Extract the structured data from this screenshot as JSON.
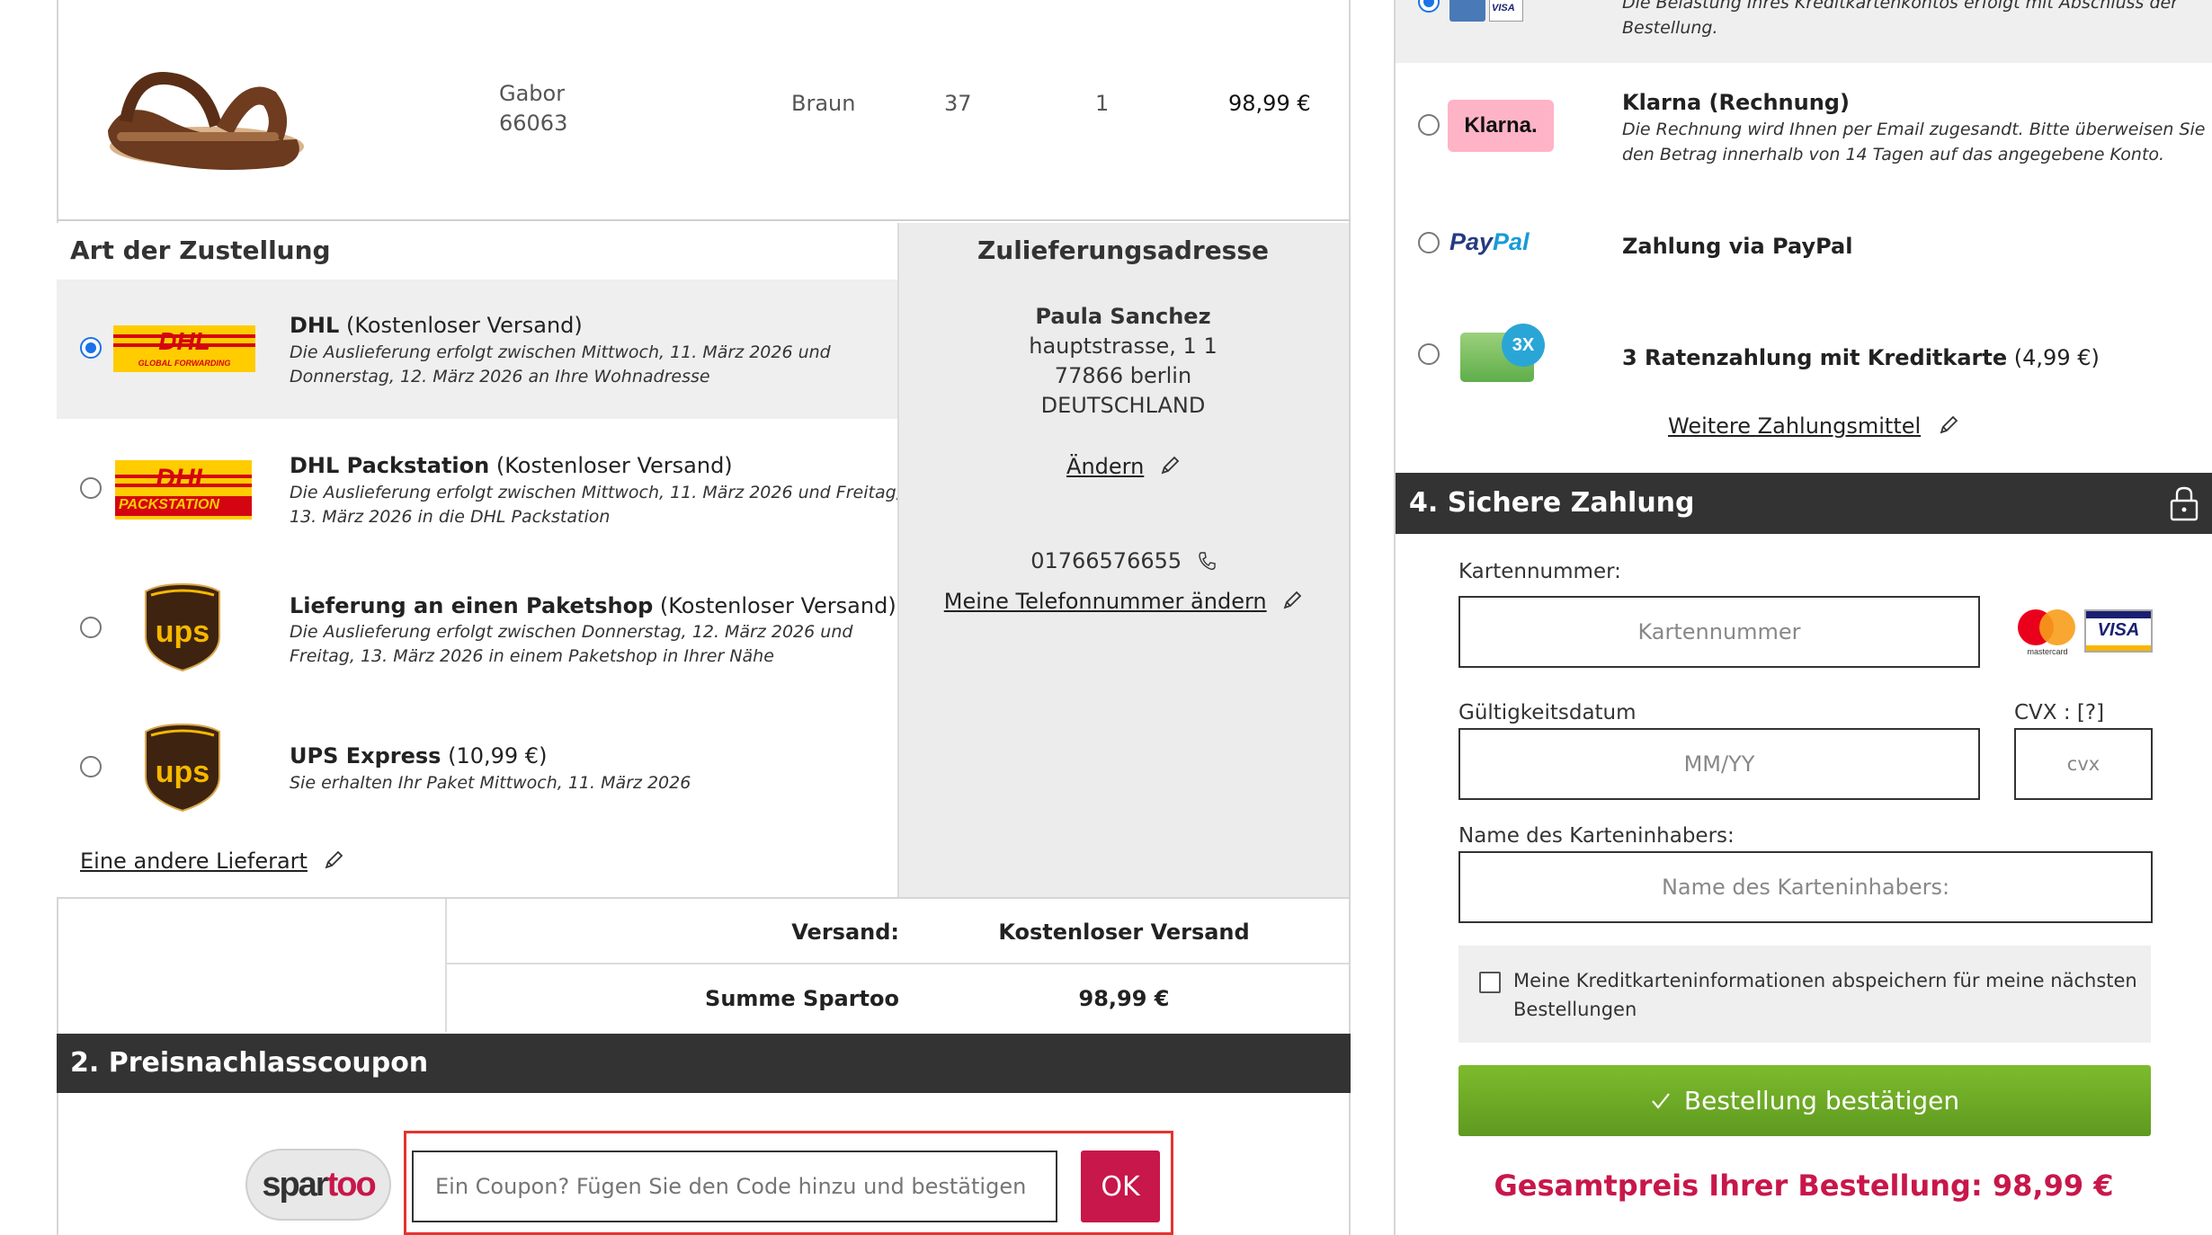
{
  "product": {
    "brand": "Gabor",
    "model": "66063",
    "color": "Braun",
    "size": "37",
    "quantity": "1",
    "price": "98,99 €"
  },
  "delivery": {
    "title": "Art der Zustellung",
    "options": [
      {
        "name": "DHL",
        "note": "(Kostenloser Versand)",
        "desc1": "Die Auslieferung erfolgt zwischen Mittwoch, 11. März 2026 und",
        "desc2": "Donnerstag, 12. März 2026 an Ihre Wohnadresse",
        "logo_text": "DHL",
        "logo_sub": "GLOBAL FORWARDING"
      },
      {
        "name": "DHL Packstation",
        "note": "(Kostenloser Versand)",
        "desc1": "Die Auslieferung erfolgt zwischen Mittwoch, 11. März 2026 und Freitag,",
        "desc2": "13. März 2026 in die DHL Packstation",
        "logo_text": "DHL",
        "logo_sub": "PACKSTATION"
      },
      {
        "name": "Lieferung an einen Paketshop",
        "note": "(Kostenloser Versand)",
        "desc1": "Die Auslieferung erfolgt zwischen Donnerstag, 12. März 2026 und",
        "desc2": "Freitag, 13. März 2026 in einem Paketshop in Ihrer Nähe",
        "logo_text": "ups"
      },
      {
        "name": "UPS Express",
        "note": "(10,99 €)",
        "desc1": "Sie erhalten Ihr Paket Mittwoch, 11. März 2026",
        "desc2": "",
        "logo_text": "ups"
      }
    ],
    "other_link": "Eine andere Lieferart"
  },
  "address": {
    "title": "Zulieferungsadresse",
    "name": "Paula Sanchez",
    "street": "hauptstrasse, 1 1",
    "city": "77866 berlin",
    "country": "DEUTSCHLAND",
    "change_link": "Ändern",
    "phone": "01766576655",
    "phone_link": "Meine Telefonnummer ändern"
  },
  "summary": {
    "shipping_label": "Versand:",
    "shipping_value": "Kostenloser Versand",
    "total_label": "Summe Spartoo",
    "total_value": "98,99 €"
  },
  "coupon": {
    "title": "2. Preisnachlasscoupon",
    "logo_a": "spar",
    "logo_b": "too",
    "placeholder": "Ein Coupon? Fügen Sie den Code hinzu und bestätigen",
    "ok_label": "OK"
  },
  "payment": {
    "card_note1": "Die Belastung Ihres Kreditkartenkontos erfolgt mit Abschluss der",
    "card_note2": "Bestellung.",
    "visa_mini": "VISA",
    "klarna_logo": "Klarna.",
    "klarna_title": "Klarna (Rechnung)",
    "klarna_desc1": "Die Rechnung wird Ihnen per Email zugesandt. Bitte überweisen Sie",
    "klarna_desc2": "den Betrag innerhalb von 14 Tagen auf das angegebene Konto.",
    "paypal_logo_a": "Pay",
    "paypal_logo_b": "Pal",
    "paypal_title": "Zahlung via PayPal",
    "rate_badge": "3X",
    "rate_title": "3 Ratenzahlung mit Kreditkarte",
    "rate_note": "(4,99 €)",
    "more_link": "Weitere Zahlungsmittel"
  },
  "secure": {
    "title": "4. Sichere Zahlung",
    "card_label": "Kartennummer:",
    "card_placeholder": "Kartennummer",
    "mastercard_text": "mastercard",
    "visa_text": "VISA",
    "expiry_label": "Gültigkeitsdatum",
    "expiry_placeholder": "MM/YY",
    "cvx_label": "CVX : [?]",
    "cvx_placeholder": "cvx",
    "holder_label": "Name des Karteninhabers:",
    "holder_placeholder": "Name des Karteninhabers:",
    "save_text1": "Meine Kreditkarteninformationen abspeichern für meine nächsten",
    "save_text2": "Bestellungen",
    "confirm_label": "Bestellung bestätigen",
    "total_text": "Gesamtpreis Ihrer Bestellung: 98,99 €"
  },
  "colors": {
    "accent_red": "#c8174a",
    "confirm_green": "#6aa823",
    "dark_bar": "#333333",
    "radio_blue": "#1a73e8"
  }
}
